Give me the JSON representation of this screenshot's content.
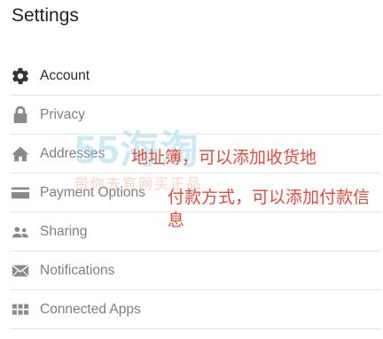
{
  "page": {
    "title": "Settings"
  },
  "menu": {
    "items": [
      {
        "label": "Account",
        "icon": "gear-icon"
      },
      {
        "label": "Privacy",
        "icon": "lock-icon"
      },
      {
        "label": "Addresses",
        "icon": "home-icon"
      },
      {
        "label": "Payment Options",
        "icon": "credit-card-icon"
      },
      {
        "label": "Sharing",
        "icon": "people-icon"
      },
      {
        "label": "Notifications",
        "icon": "envelope-icon"
      },
      {
        "label": "Connected Apps",
        "icon": "apps-grid-icon"
      }
    ]
  },
  "watermark": {
    "logo": "55海淘",
    "tagline": "带你去官网买正品"
  },
  "annotations": {
    "addresses_note": "地址簿，可以添加收货地",
    "payment_note": "付款方式，可以添加付款信息"
  },
  "colors": {
    "active_text": "#2b2b2b",
    "inactive_text": "#7f7f7f",
    "active_icon": "#333333",
    "inactive_icon": "#8a8a8a",
    "annotation": "#e84a3c",
    "divider": "#e4e4e4"
  }
}
